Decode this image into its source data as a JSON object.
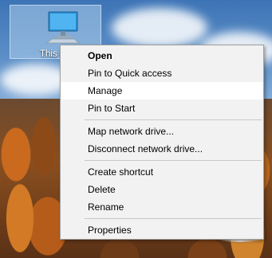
{
  "desktop": {
    "icon": {
      "label": "This PC",
      "name": "this-pc"
    }
  },
  "context_menu": {
    "groups": [
      [
        {
          "label": "Open",
          "bold": true,
          "highlighted": false
        },
        {
          "label": "Pin to Quick access",
          "bold": false,
          "highlighted": false
        },
        {
          "label": "Manage",
          "bold": false,
          "highlighted": true
        },
        {
          "label": "Pin to Start",
          "bold": false,
          "highlighted": false
        }
      ],
      [
        {
          "label": "Map network drive...",
          "bold": false,
          "highlighted": false
        },
        {
          "label": "Disconnect network drive...",
          "bold": false,
          "highlighted": false
        }
      ],
      [
        {
          "label": "Create shortcut",
          "bold": false,
          "highlighted": false
        },
        {
          "label": "Delete",
          "bold": false,
          "highlighted": false
        },
        {
          "label": "Rename",
          "bold": false,
          "highlighted": false
        }
      ],
      [
        {
          "label": "Properties",
          "bold": false,
          "highlighted": false
        }
      ]
    ]
  },
  "colors": {
    "menu_bg": "#f2f2f2",
    "menu_hover": "#ffffff",
    "icon_selection": "#adcdeb"
  }
}
